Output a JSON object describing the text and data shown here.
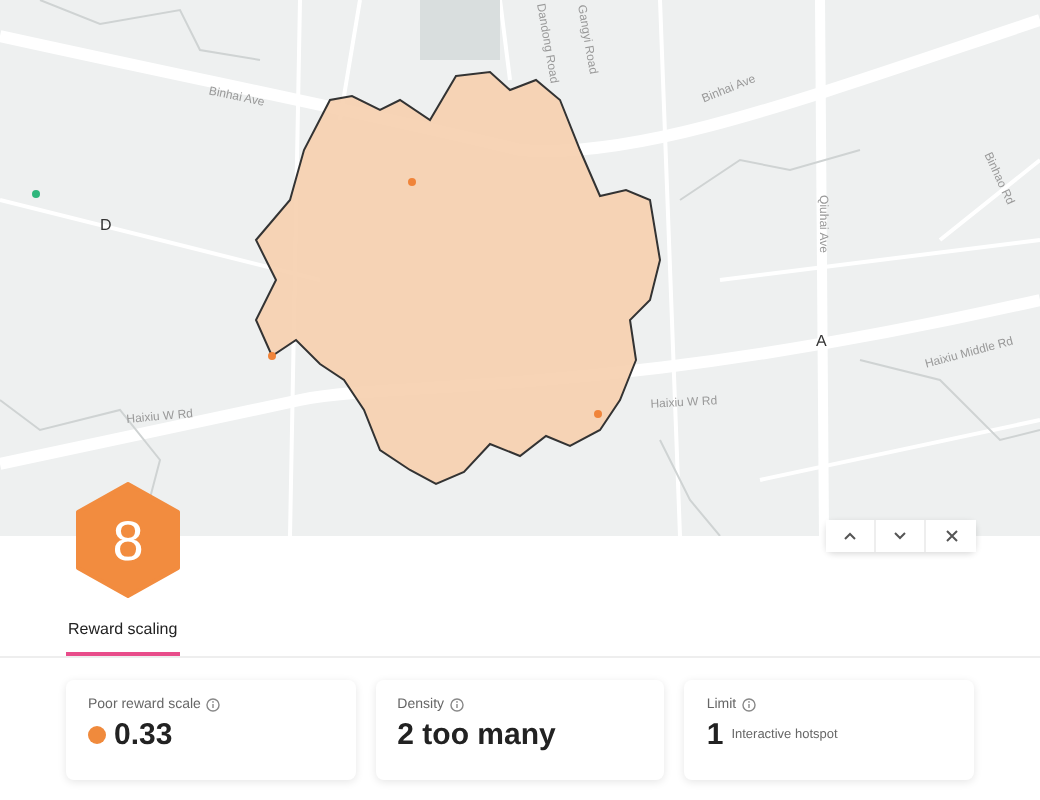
{
  "map": {
    "street_labels": [
      "Binhai Ave",
      "Binhai Ave",
      "Dandong Road",
      "Gangyi Road",
      "Binhao Rd",
      "Qiuhai Ave",
      "Haixiu W Rd",
      "Haixiu W Rd",
      "Haixiu Middle Rd"
    ],
    "area_labels": [
      "D",
      "A"
    ],
    "pins": [
      {
        "color": "#2fb67c"
      },
      {
        "color": "#f0843a"
      },
      {
        "color": "#f0843a"
      },
      {
        "color": "#f0843a"
      }
    ]
  },
  "hex_badge": {
    "value": "8"
  },
  "tabs": [
    {
      "label": "Reward scaling",
      "selected": true
    }
  ],
  "cards": [
    {
      "kind": "score",
      "label": "Poor reward scale",
      "value": "0.33",
      "color": "#f08a3c"
    },
    {
      "kind": "plain",
      "label": "Density",
      "value": "2 too many"
    },
    {
      "kind": "count",
      "label": "Limit",
      "value": "1",
      "unit": "Interactive hotspot"
    }
  ]
}
